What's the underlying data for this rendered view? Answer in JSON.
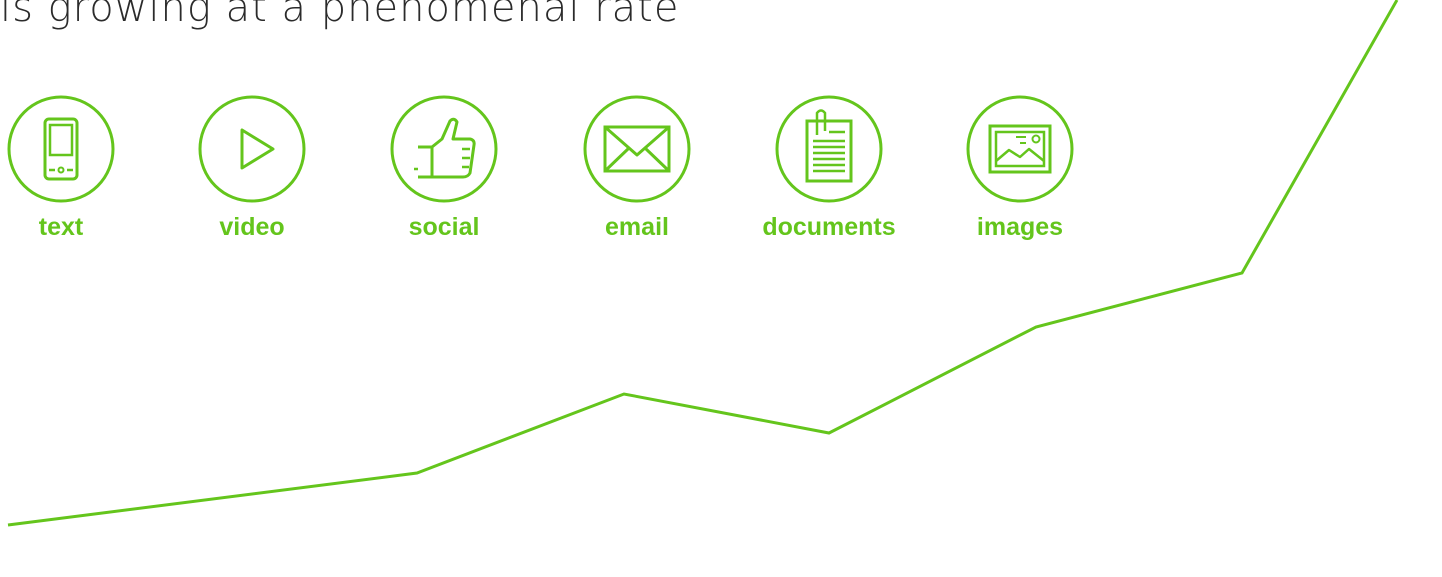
{
  "headline": "is growing at a phenomenal rate",
  "accent_color": "#64c51c",
  "icons": [
    {
      "label": "text",
      "icon": "phone-icon"
    },
    {
      "label": "video",
      "icon": "play-icon"
    },
    {
      "label": "social",
      "icon": "thumbs-up-icon"
    },
    {
      "label": "email",
      "icon": "envelope-icon"
    },
    {
      "label": "documents",
      "icon": "document-icon"
    },
    {
      "label": "images",
      "icon": "image-icon"
    }
  ]
}
